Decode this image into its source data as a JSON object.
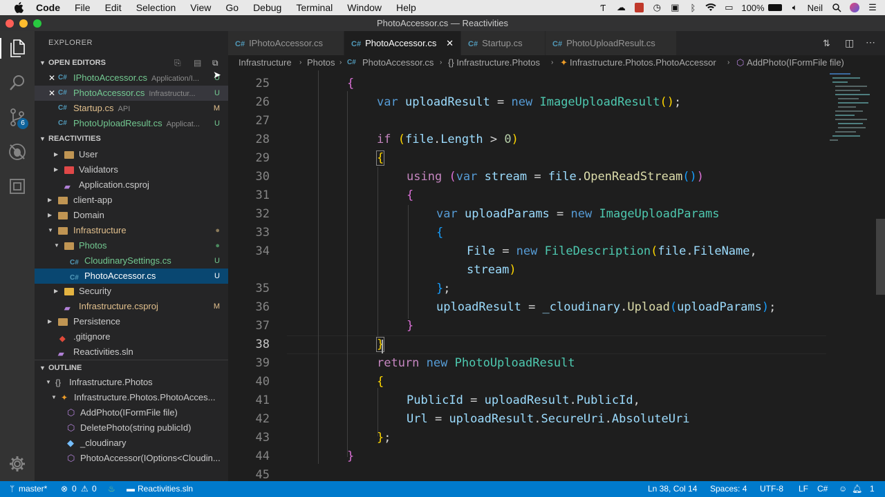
{
  "menubar": {
    "app": "Code",
    "items": [
      "File",
      "Edit",
      "Selection",
      "View",
      "Go",
      "Debug",
      "Terminal",
      "Window",
      "Help"
    ],
    "battery": "100%",
    "user": "Neil"
  },
  "window": {
    "title": "PhotoAccessor.cs — Reactivities"
  },
  "explorer": {
    "title": "EXPLORER",
    "open_editors_title": "OPEN EDITORS",
    "open_editors": [
      {
        "name": "IPhotoAccessor.cs",
        "desc": "Application/I...",
        "status": "U",
        "color": "#73c991"
      },
      {
        "name": "PhotoAccessor.cs",
        "desc": "Infrastructur...",
        "status": "U",
        "color": "#73c991"
      },
      {
        "name": "Startup.cs",
        "desc": "API",
        "status": "M",
        "color": "#e2c08d"
      },
      {
        "name": "PhotoUploadResult.cs",
        "desc": "Applicat...",
        "status": "U",
        "color": "#73c991"
      }
    ],
    "project_title": "REACTIVITIES",
    "tree": [
      {
        "name": "User",
        "status": ""
      },
      {
        "name": "Validators",
        "status": ""
      },
      {
        "name": "Application.csproj",
        "status": ""
      },
      {
        "name": "client-app",
        "status": ""
      },
      {
        "name": "Domain",
        "status": ""
      },
      {
        "name": "Infrastructure",
        "status": ""
      },
      {
        "name": "Photos",
        "status": ""
      },
      {
        "name": "CloudinarySettings.cs",
        "status": "U"
      },
      {
        "name": "PhotoAccessor.cs",
        "status": "U"
      },
      {
        "name": "Security",
        "status": ""
      },
      {
        "name": "Infrastructure.csproj",
        "status": "M"
      },
      {
        "name": "Persistence",
        "status": ""
      },
      {
        "name": ".gitignore",
        "status": ""
      },
      {
        "name": "Reactivities.sln",
        "status": ""
      }
    ],
    "outline_title": "OUTLINE",
    "outline": [
      "Infrastructure.Photos",
      "Infrastructure.Photos.PhotoAcces...",
      "AddPhoto(IFormFile file)",
      "DeletePhoto(string publicId)",
      "_cloudinary",
      "PhotoAccessor(IOptions<Cloudin..."
    ]
  },
  "tabs": [
    "IPhotoAccessor.cs",
    "PhotoAccessor.cs",
    "Startup.cs",
    "PhotoUploadResult.cs"
  ],
  "tab_cs": "C#",
  "breadcrumb": [
    "Infrastructure",
    "Photos",
    "PhotoAccessor.cs",
    "{} Infrastructure.Photos",
    "Infrastructure.Photos.PhotoAccessor",
    "AddPhoto(IFormFile file)"
  ],
  "line_numbers": [
    "25",
    "26",
    "27",
    "28",
    "29",
    "30",
    "31",
    "32",
    "33",
    "34",
    "35",
    "36",
    "37",
    "38",
    "39",
    "40",
    "41",
    "42",
    "43",
    "44",
    "45"
  ],
  "status": {
    "branch": "master*",
    "errors": "0",
    "warnings": "0",
    "solution": "Reactivities.sln",
    "position": "Ln 38, Col 14",
    "spaces": "Spaces: 4",
    "encoding": "UTF-8",
    "eol": "LF",
    "language": "C#",
    "notifications": "1"
  },
  "scm_badge": "6",
  "colors": {
    "accent": "#007acc",
    "selection": "#094771",
    "untracked": "#73c991",
    "modified": "#e2c08d"
  }
}
